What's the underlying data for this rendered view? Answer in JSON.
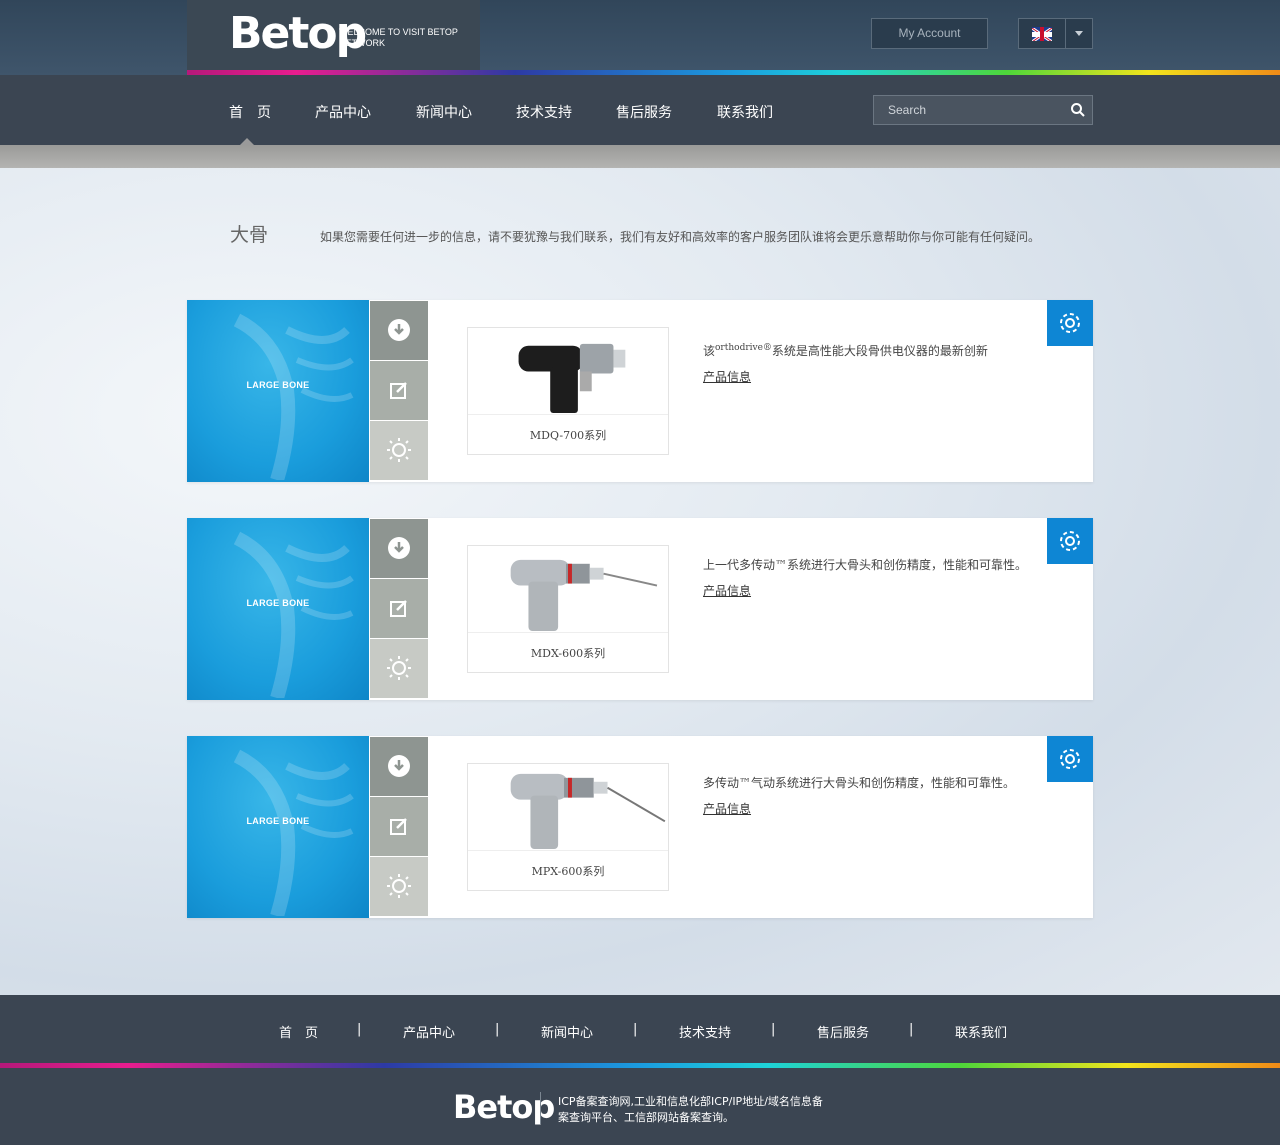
{
  "header": {
    "logo": "Betop",
    "tagline_line1": "WELCOME TO VISIT BETOP",
    "tagline_line2": "NETWORK",
    "account_label": "My Account",
    "language": "UK"
  },
  "nav": {
    "items": [
      "首　页",
      "产品中心",
      "新闻中心",
      "技术支持",
      "售后服务",
      "联系我们"
    ],
    "active": 0
  },
  "search": {
    "placeholder": "Search"
  },
  "page": {
    "title": "大骨",
    "description": "如果您需要任何进一步的信息，请不要犹豫与我们联系，我们有友好和高效率的客户服务团队谁将会更乐意帮助你与你可能有任何疑问。"
  },
  "products": [
    {
      "banner": "LARGE BONE",
      "name": "MDQ-700系列",
      "desc_before": "该",
      "desc_sup": "orthodrive®",
      "desc_after": "系统是高性能大段骨供电仪器的最新创新",
      "link": "产品信息"
    },
    {
      "banner": "LARGE BONE",
      "name": "MDX-600系列",
      "desc_before": "上一代多传动",
      "desc_sup": "",
      "desc_after": "™系统进行大骨头和创伤精度，性能和可靠性。",
      "link": "产品信息"
    },
    {
      "banner": "LARGE BONE",
      "name": "MPX-600系列",
      "desc_before": "多传动",
      "desc_sup": "",
      "desc_after": "™气动系统进行大骨头和创伤精度，性能和可靠性。",
      "link": "产品信息"
    }
  ],
  "footer": {
    "nav": [
      "首　页",
      "产品中心",
      "新闻中心",
      "技术支持",
      "售后服务",
      "联系我们"
    ],
    "separator": "|",
    "logo": "Betop",
    "copyright_line1": "ICP备案查询网,工业和信息化部ICP/IP地址/域名信息备",
    "copyright_line2": "案查询平台、工信部网站备案查询。"
  },
  "colors": {
    "nav_bg": "#3b4552",
    "accent_blue": "#0e86d4",
    "banner_blue": "#1a9ddc"
  }
}
